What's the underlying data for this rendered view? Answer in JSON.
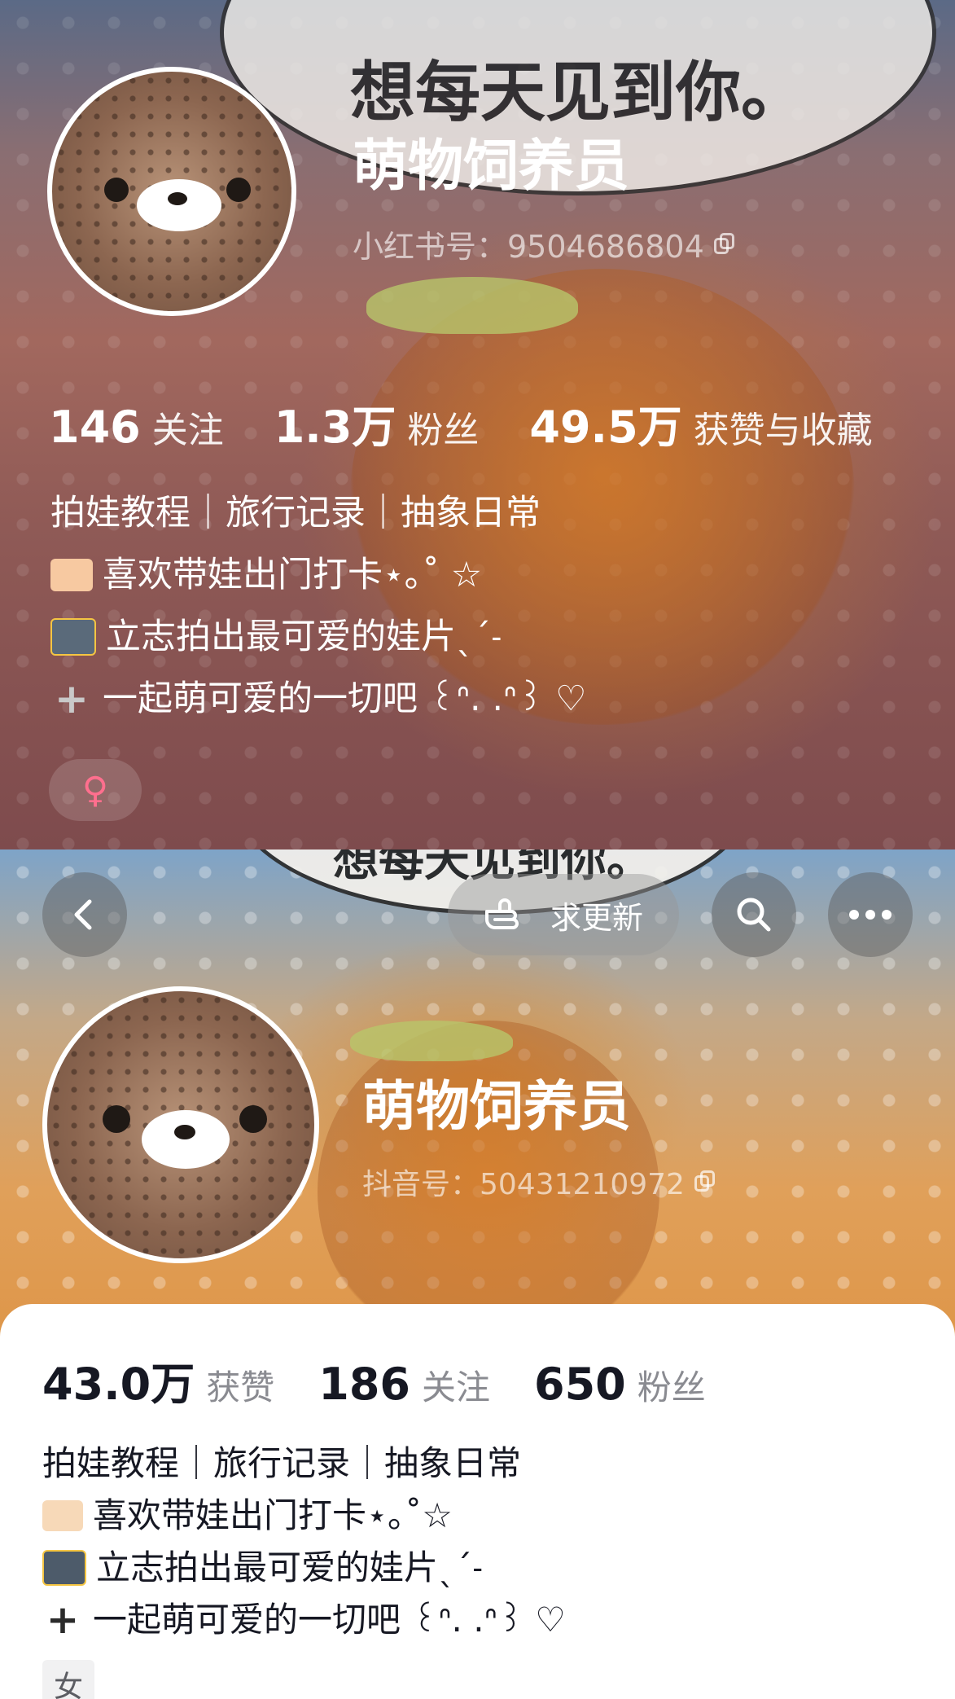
{
  "top_profile": {
    "banner_text": "想每天见到你。",
    "nickname": "萌物饲养员",
    "account_id": "小红书号：9504686804",
    "stats": [
      {
        "value": "146",
        "label": "关注"
      },
      {
        "value": "1.3万",
        "label": "粉丝"
      },
      {
        "value": "49.5万",
        "label": "获赞与收藏"
      }
    ],
    "bio": {
      "line1": "拍娃教程｜旅行记录｜抽象日常",
      "line2": "喜欢带娃出门打卡⋆｡˚ ☆",
      "line3": "立志拍出最可爱的娃片ˎˊ˗",
      "line4": "一起萌可爱的一切吧 ꒰ᐢ. .ᐢ꒱ ♡"
    },
    "gender_symbol": "♀"
  },
  "bottom_profile": {
    "banner_text": "想每天见到你。",
    "request_update_label": "求更新",
    "nickname": "萌物饲养员",
    "account_id": "抖音号：50431210972",
    "stats": [
      {
        "value": "43.0万",
        "label": "获赞"
      },
      {
        "value": "186",
        "label": "关注"
      },
      {
        "value": "650",
        "label": "粉丝"
      }
    ],
    "bio": {
      "line1": "拍娃教程｜旅行记录｜抽象日常",
      "line2": "喜欢带娃出门打卡⋆｡˚☆",
      "line3": "立志拍出最可爱的娃片ˎˊ˗",
      "line4": "一起萌可爱的一切吧 ꒰ᐢ. .ᐢ꒱ ♡"
    },
    "gender_tag": "女"
  },
  "icons": [
    "back-icon",
    "pointing-hand-icon",
    "search-icon",
    "more-icon",
    "copy-icon",
    "heart-hands-icon",
    "camera-flash-icon",
    "plus-icon",
    "female-icon"
  ],
  "colors": {
    "dark_text": "#161823",
    "muted_text": "#8a8b91",
    "female_pink": "#ff6f8e"
  }
}
